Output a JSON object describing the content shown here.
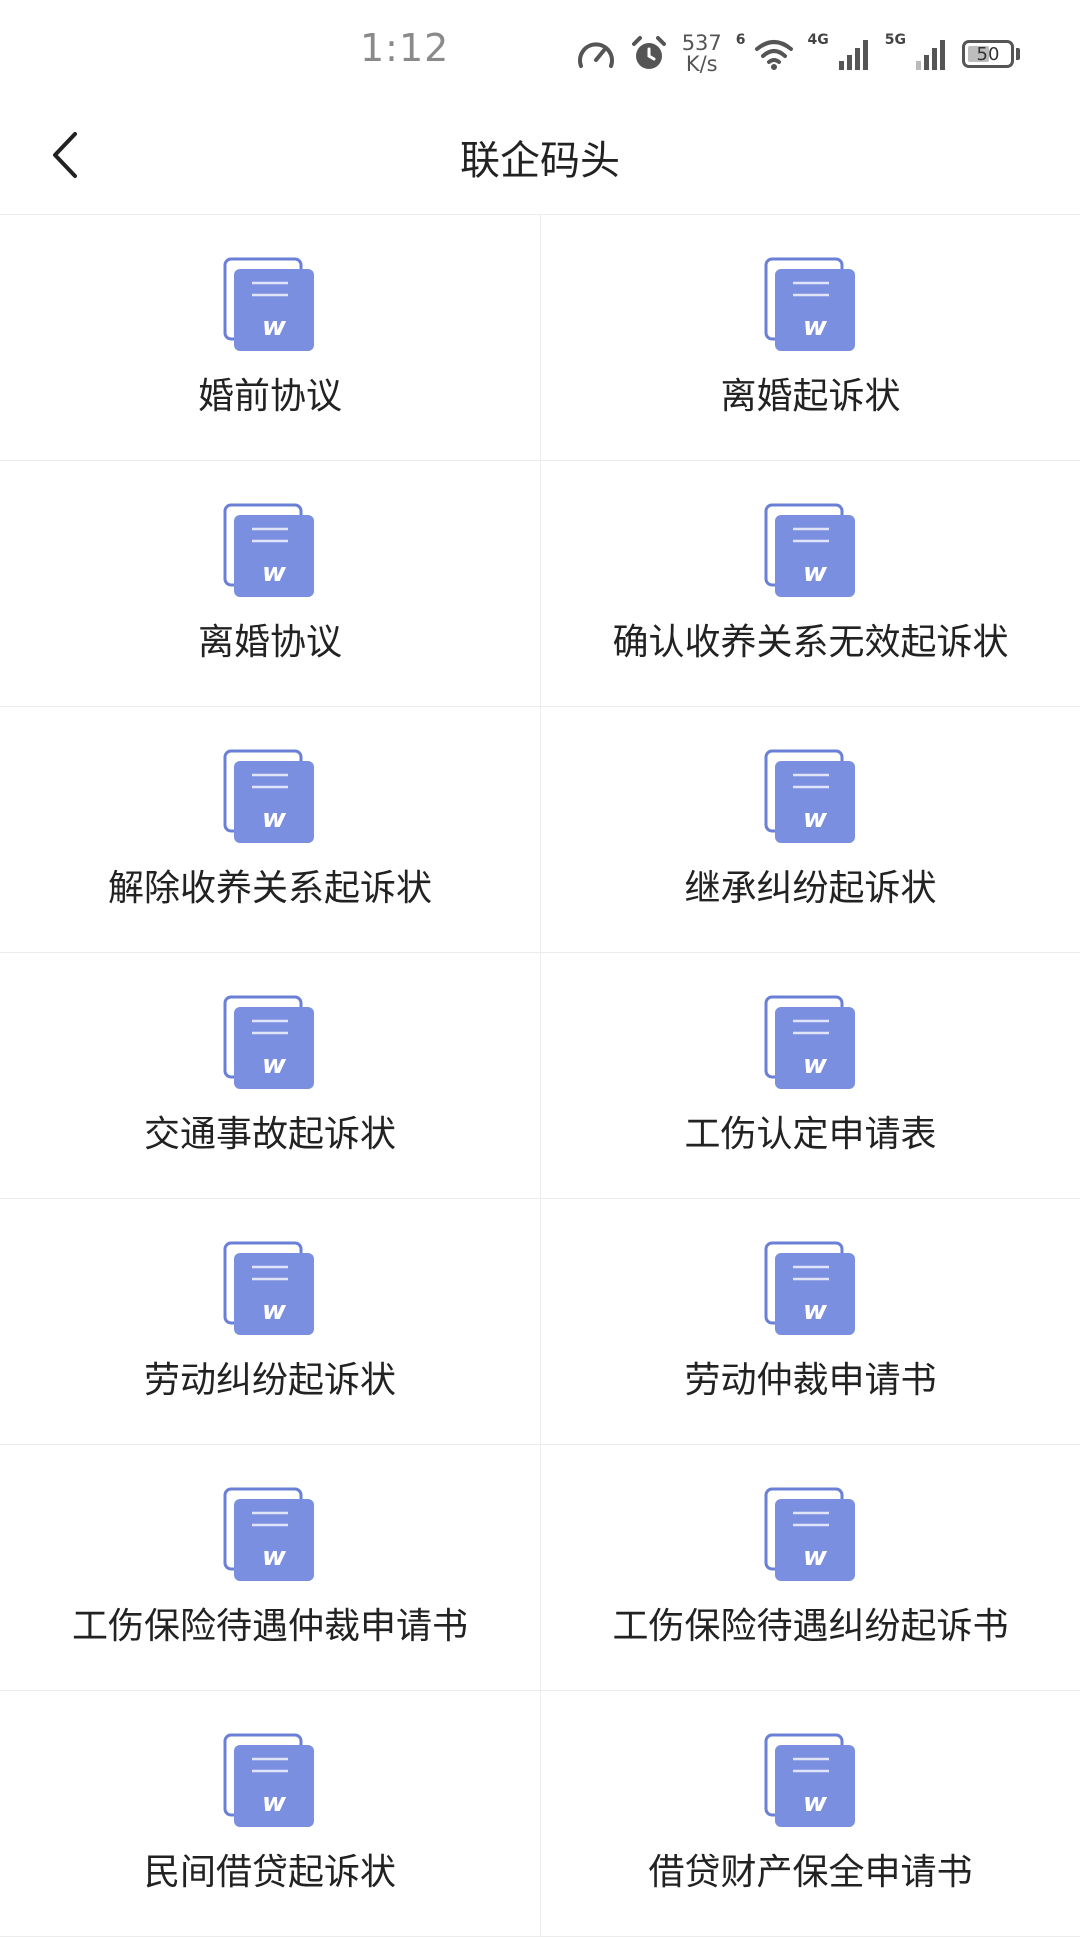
{
  "status_bar": {
    "time": "1:12",
    "speed_top": "537",
    "speed_bottom": "K/s",
    "wifi_label": "6",
    "net1_label": "4G",
    "net2_label": "5G",
    "battery": "50"
  },
  "header": {
    "title": "联企码头"
  },
  "documents": [
    {
      "label": "婚前协议"
    },
    {
      "label": "离婚起诉状"
    },
    {
      "label": "离婚协议"
    },
    {
      "label": "确认收养关系无效起诉状"
    },
    {
      "label": "解除收养关系起诉状"
    },
    {
      "label": "继承纠纷起诉状"
    },
    {
      "label": "交通事故起诉状"
    },
    {
      "label": "工伤认定申请表"
    },
    {
      "label": "劳动纠纷起诉状"
    },
    {
      "label": "劳动仲裁申请书"
    },
    {
      "label": "工伤保险待遇仲裁申请书"
    },
    {
      "label": "工伤保险待遇纠纷起诉书"
    },
    {
      "label": "民间借贷起诉状"
    },
    {
      "label": "借贷财产保全申请书"
    }
  ],
  "icons": {
    "document": "word-document-icon",
    "back": "back-arrow-icon"
  },
  "colors": {
    "doc_icon": "#7b8fe0",
    "doc_icon_back": "#6a7fd6"
  }
}
